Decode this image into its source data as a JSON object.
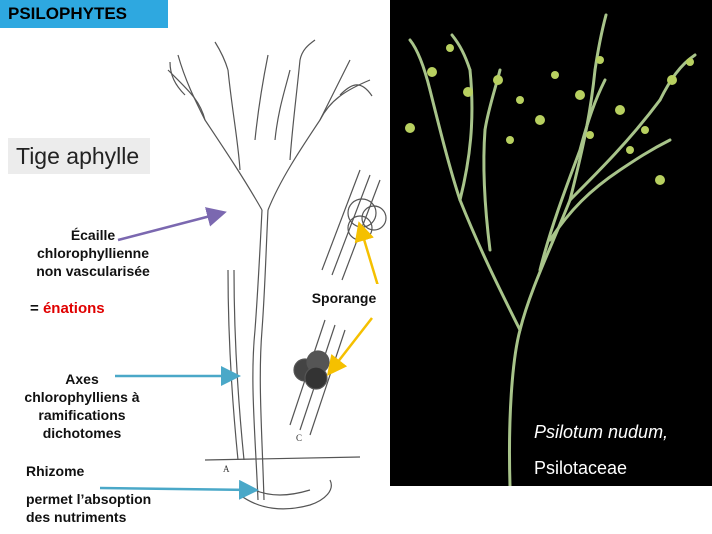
{
  "header": {
    "title": "PSILOPHYTES"
  },
  "labels": {
    "tige": "Tige aphylle",
    "ecaille_line1": "Écaille",
    "ecaille_line2": "chlorophyllienne",
    "ecaille_line3": "non vascularisée",
    "enations_prefix": "= ",
    "enations": "énations",
    "sporange": "Sporange",
    "axes_line1": "Axes",
    "axes_line2": "chlorophylliens à",
    "axes_line3": "ramifications",
    "axes_line4": "dichotomes",
    "rhizome": "Rhizome",
    "rhizome_desc_line1": "permet l’absoption",
    "rhizome_desc_line2": "des nutriments",
    "drawing_letter_a": "A",
    "drawing_letter_c": "C"
  },
  "photo": {
    "caption_species": "Psilotum nudum,",
    "caption_family": "Psilotaceae"
  },
  "colors": {
    "title_bg": "#2ea8e0",
    "arrow_purple": "#7b68b0",
    "arrow_blue": "#4aa8c8",
    "arrow_yellow": "#f5c000",
    "enations_red": "#e00000"
  }
}
